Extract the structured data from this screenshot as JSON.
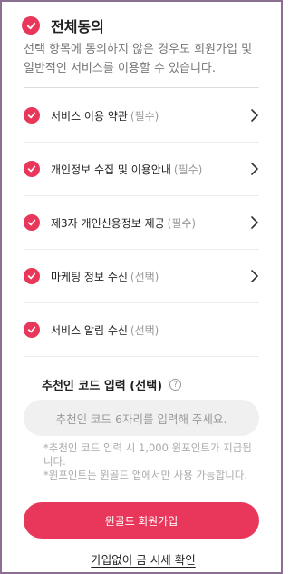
{
  "all_agree": {
    "label": "전체동의",
    "desc": "선택 항목에 동의하지 않은 경우도 회원가입 및 일반적인 서비스를 이용할 수 있습니다."
  },
  "items": [
    {
      "label": "서비스 이용 약관",
      "tag": "(필수)",
      "has_arrow": true
    },
    {
      "label": "개인정보 수집 및 이용안내",
      "tag": "(필수)",
      "has_arrow": true
    },
    {
      "label": "제3자 개인신용정보 제공",
      "tag": "(필수)",
      "has_arrow": true
    },
    {
      "label": "마케팅 정보 수신",
      "tag": "(선택)",
      "has_arrow": true
    },
    {
      "label": "서비스 알림 수신",
      "tag": "(선택)",
      "has_arrow": false
    }
  ],
  "recommend": {
    "title": "추천인 코드 입력 (선택)",
    "help_icon": "?",
    "placeholder": "추천인 코드 6자리를 입력해 주세요.",
    "note1": "*추천인 코드 입력 시 1,000 윈포인트가 지급됩니다.",
    "note2": "*윈포인트는 윈골드 앱에서만 사용 가능합니다."
  },
  "join_button": "윈골드 회원가입",
  "link_text": "가입없이 금 시세 확인",
  "colors": {
    "accent": "#e8375a",
    "frame": "#8a6f90"
  }
}
